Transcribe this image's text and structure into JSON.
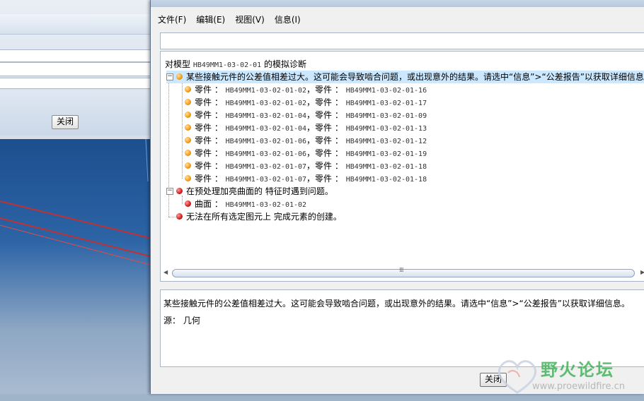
{
  "background_app": {
    "close_label": "关闭"
  },
  "dialog": {
    "menu": [
      {
        "label": "文件(F)"
      },
      {
        "label": "编辑(E)"
      },
      {
        "label": "视图(V)"
      },
      {
        "label": "信息(I)"
      }
    ],
    "header_prefix": "对模型",
    "model_name": "HB49MM1-03-02-01",
    "header_suffix": "的模拟诊断",
    "tree": {
      "group1": {
        "label": "某些接触元件的公差值相差过大。这可能会导致啮合问题，或出现意外的结果。请选中“信息”>“公差报告”以获取详细信息。",
        "icon": "warning-orange",
        "children": [
          {
            "prefix": "零件 ：",
            "a": "HB49MM1-03-02-01-02",
            "sep": "，零件 ：",
            "b": "HB49MM1-03-02-01-16"
          },
          {
            "prefix": "零件 ：",
            "a": "HB49MM1-03-02-01-02",
            "sep": "，零件 ：",
            "b": "HB49MM1-03-02-01-17"
          },
          {
            "prefix": "零件 ：",
            "a": "HB49MM1-03-02-01-04",
            "sep": "，零件 ：",
            "b": "HB49MM1-03-02-01-09"
          },
          {
            "prefix": "零件 ：",
            "a": "HB49MM1-03-02-01-04",
            "sep": "，零件 ：",
            "b": "HB49MM1-03-02-01-13"
          },
          {
            "prefix": "零件 ：",
            "a": "HB49MM1-03-02-01-06",
            "sep": "，零件 ：",
            "b": "HB49MM1-03-02-01-12"
          },
          {
            "prefix": "零件 ：",
            "a": "HB49MM1-03-02-01-06",
            "sep": "，零件 ：",
            "b": "HB49MM1-03-02-01-19"
          },
          {
            "prefix": "零件 ：",
            "a": "HB49MM1-03-02-01-07",
            "sep": "，零件 ：",
            "b": "HB49MM1-03-02-01-18"
          },
          {
            "prefix": "零件 ：",
            "a": "HB49MM1-03-02-01-07",
            "sep": "，零件 ：",
            "b": "HB49MM1-03-02-01-18"
          }
        ]
      },
      "group2": {
        "label": "在预处理加亮曲面的 特征时遇到问题。",
        "icon": "error-red",
        "children": [
          {
            "prefix": "曲面 ：",
            "a": "HB49MM1-03-02-01-02"
          }
        ]
      },
      "group3": {
        "label": "无法在所有选定图元上 完成元素的创建。",
        "icon": "error-red"
      }
    },
    "detail_text": "某些接触元件的公差值相差过大。这可能会导致啮合问题，或出现意外的结果。请选中“信息”>“公差报告”以获取详细信息。",
    "source_text": "源： 几何",
    "close_label": "关闭",
    "scroll_grip": "⁞⁞⁞",
    "colors": {
      "selection": "#cce8ff",
      "warning": "#f39a12",
      "error": "#d11c1c",
      "viewport": "#2c64a6"
    }
  },
  "watermark": {
    "text": "野火论坛",
    "url": "www.proewildfire.cn"
  }
}
